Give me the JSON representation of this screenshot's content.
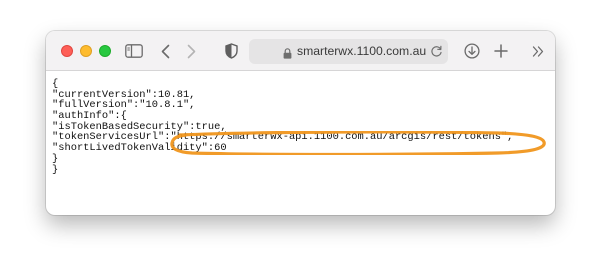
{
  "browser": {
    "address_bar": {
      "url": "smarterwx.1100.com.au"
    },
    "icons": {
      "sidebar": "sidebar-icon",
      "back": "chevron-left-icon",
      "forward": "chevron-right-icon",
      "privacy": "shield-icon",
      "lock": "lock-icon",
      "reload": "reload-icon",
      "download": "download-icon",
      "new_tab": "plus-icon",
      "more": "double-chevron-right-icon"
    },
    "colors": {
      "close": "#fe5f57",
      "minimize": "#febc2e",
      "zoom": "#28c840",
      "annotation": "#f0961e"
    }
  },
  "page": {
    "json_lines": [
      "{",
      "\"currentVersion\":10.81,",
      "\"fullVersion\":\"10.8.1\",",
      "\"authInfo\":{",
      "\"isTokenBasedSecurity\":true,",
      "\"tokenServicesUrl\":\"https://smarterwx-api.1100.com.au/arcgis/rest/tokens\",",
      "\"shortLivedTokenValidity\":60",
      "}",
      "}"
    ]
  }
}
